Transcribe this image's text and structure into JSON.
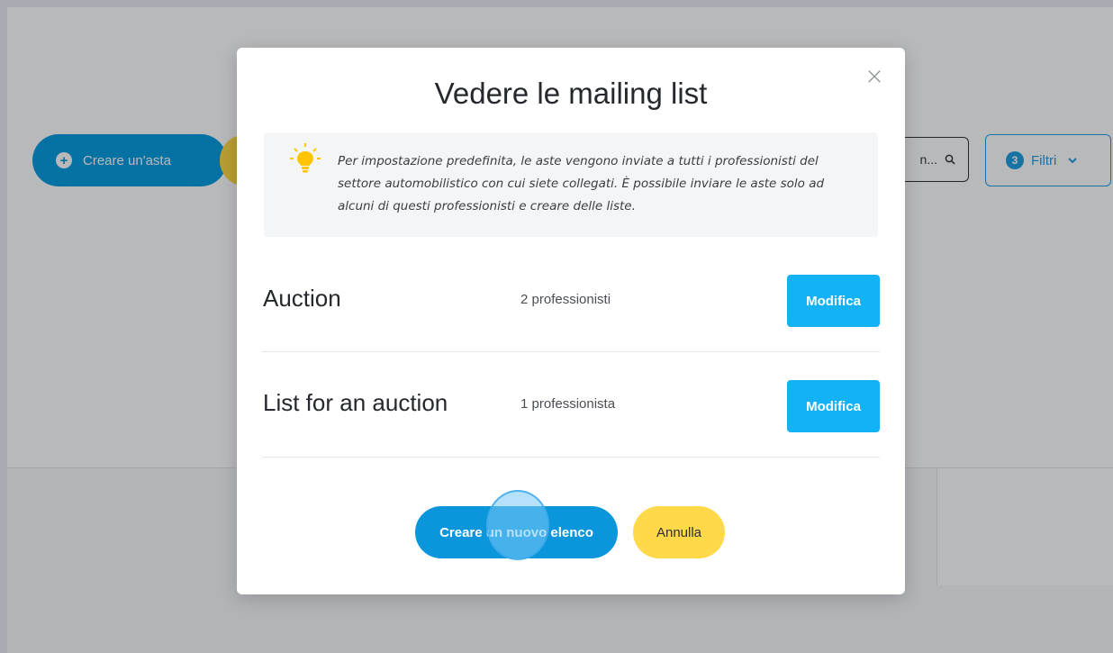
{
  "background": {
    "create_auction_label": "Creare un'asta",
    "search_text": "n...",
    "filters_count": "3",
    "filters_label": "Filtri"
  },
  "modal": {
    "title": "Vedere le mailing list",
    "info_text": "Per impostazione predefinita, le aste vengono inviate a tutti i professionisti del settore automobilistico con cui siete collegati. È possibile inviare le aste solo ad alcuni di questi professionisti e creare delle liste.",
    "lists": [
      {
        "name": "Auction",
        "count": "2 professionisti",
        "edit_label": "Modifica"
      },
      {
        "name": "List for an auction",
        "count": "1 professionista",
        "edit_label": "Modifica"
      }
    ],
    "create_button_label": "Creare un nuovo elenco",
    "cancel_button_label": "Annulla"
  },
  "colors": {
    "primary_blue": "#0b96dc",
    "edit_blue": "#12b2f5",
    "yellow": "#ffd94a",
    "bulb_yellow": "#ffc400"
  }
}
